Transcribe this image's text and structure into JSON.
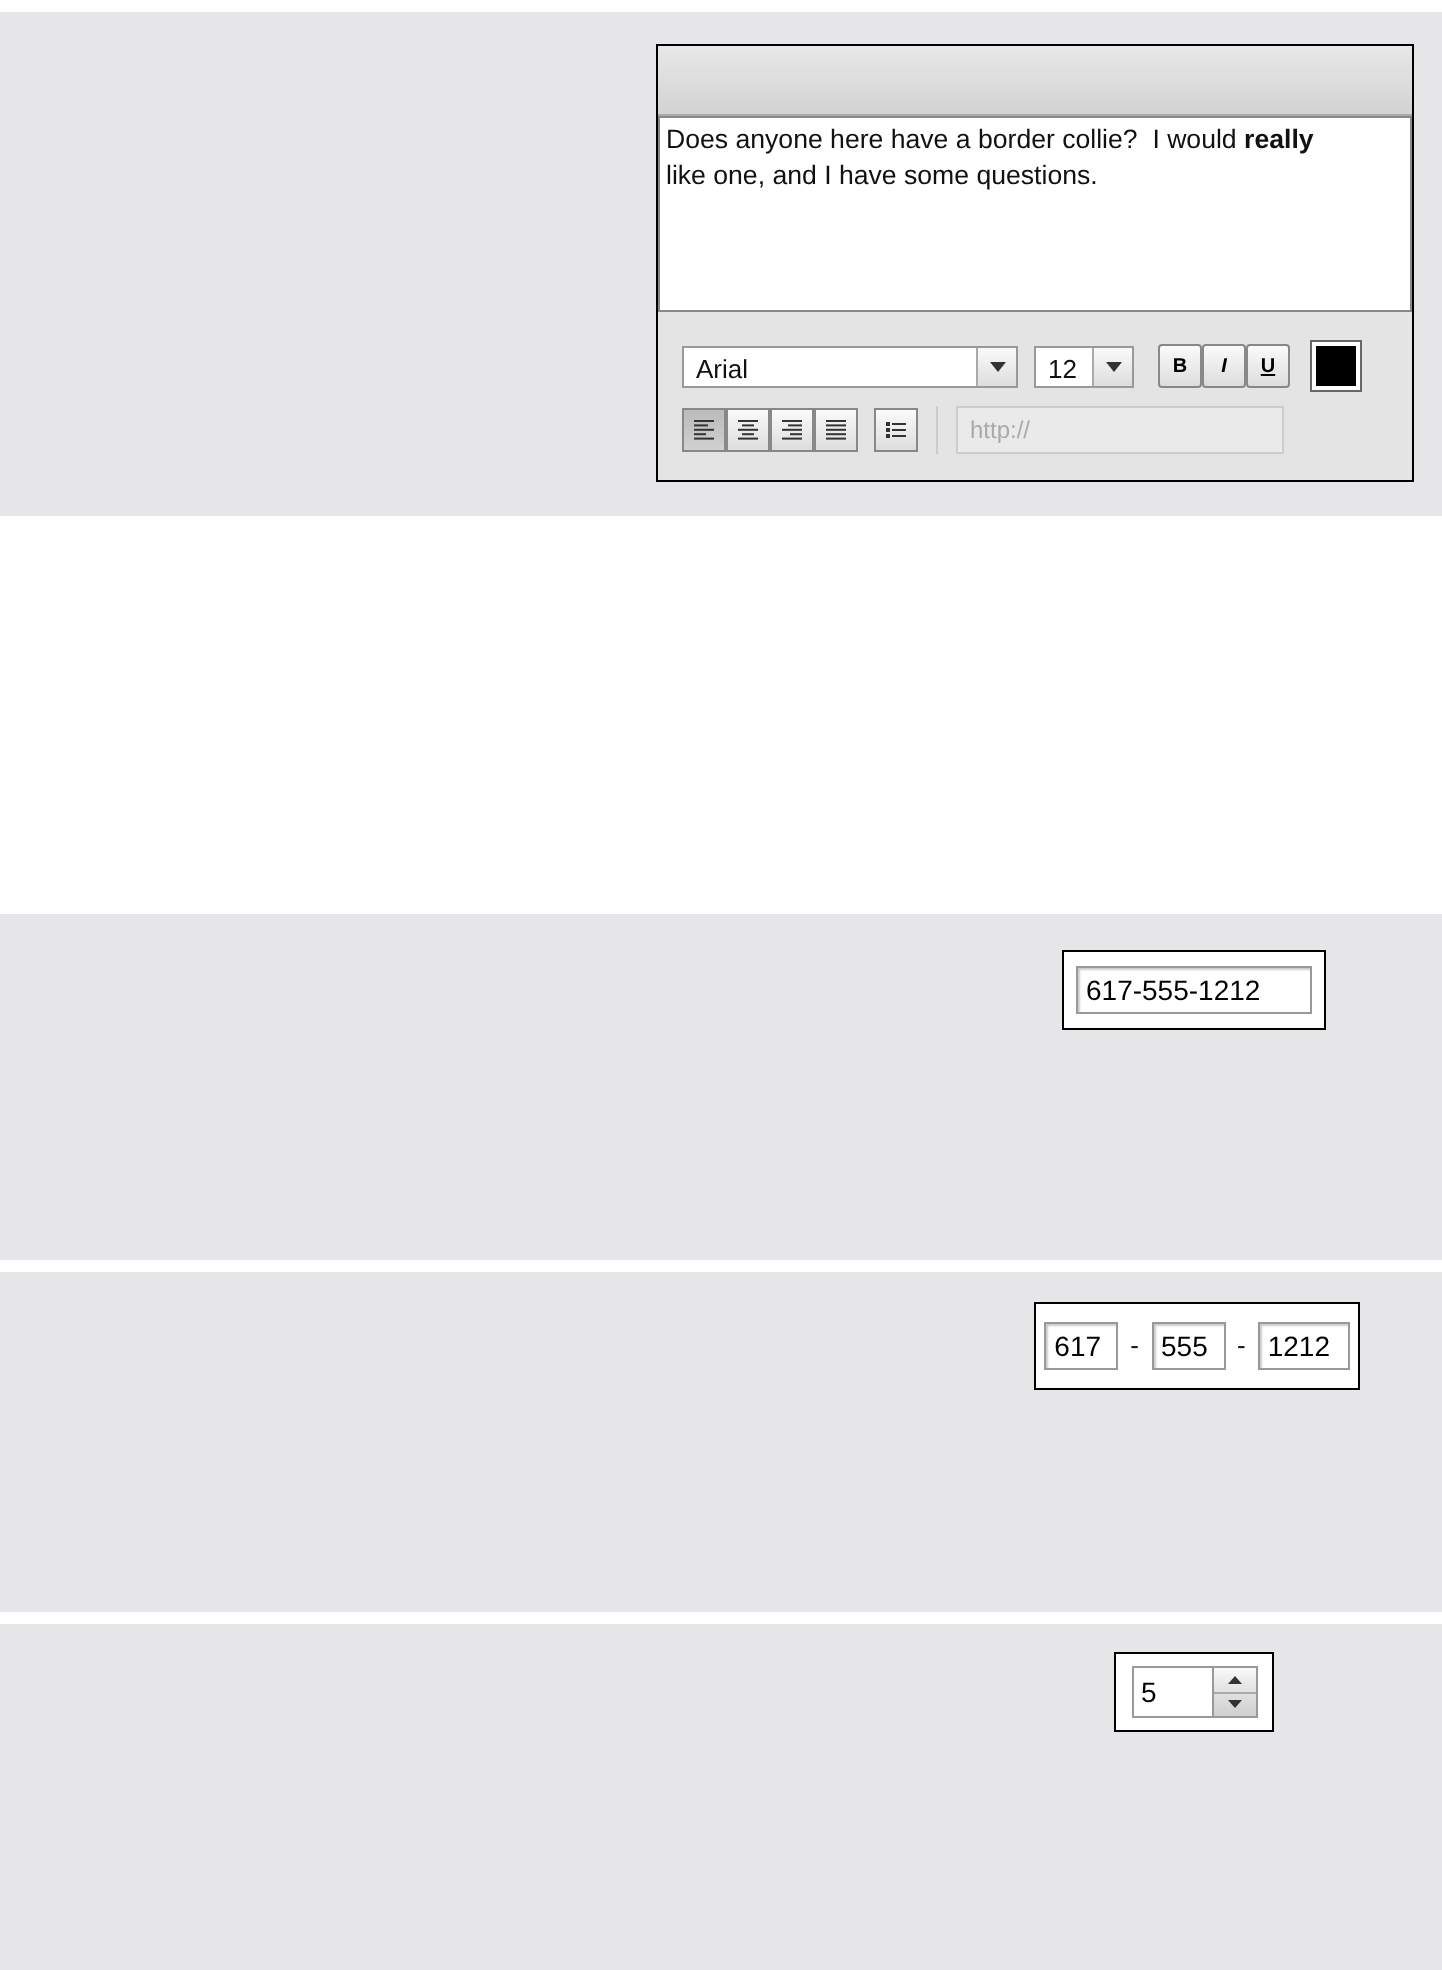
{
  "editor": {
    "message": "Does anyone here have a border collie?  I would **really** like one, and I have some questions.",
    "font": {
      "value": "Arial"
    },
    "size": {
      "value": "12"
    },
    "style_buttons": [
      {
        "kind": "bold",
        "label": "B"
      },
      {
        "kind": "italic",
        "label": "I"
      },
      {
        "kind": "underline",
        "label": "U"
      }
    ],
    "text_color": {
      "color": "#000000"
    },
    "align_buttons": [
      {
        "kind": "left",
        "selected": true
      },
      {
        "kind": "center",
        "selected": false
      },
      {
        "kind": "right",
        "selected": false
      },
      {
        "kind": "justify",
        "selected": false
      }
    ],
    "link": {
      "placeholder": "http://"
    }
  },
  "phone_single": {
    "value": "617-555-1212"
  },
  "phone_split": {
    "parts": [
      "617",
      "555",
      "1212"
    ],
    "separators": [
      "-",
      "-"
    ]
  },
  "spinner": {
    "value": "5"
  }
}
